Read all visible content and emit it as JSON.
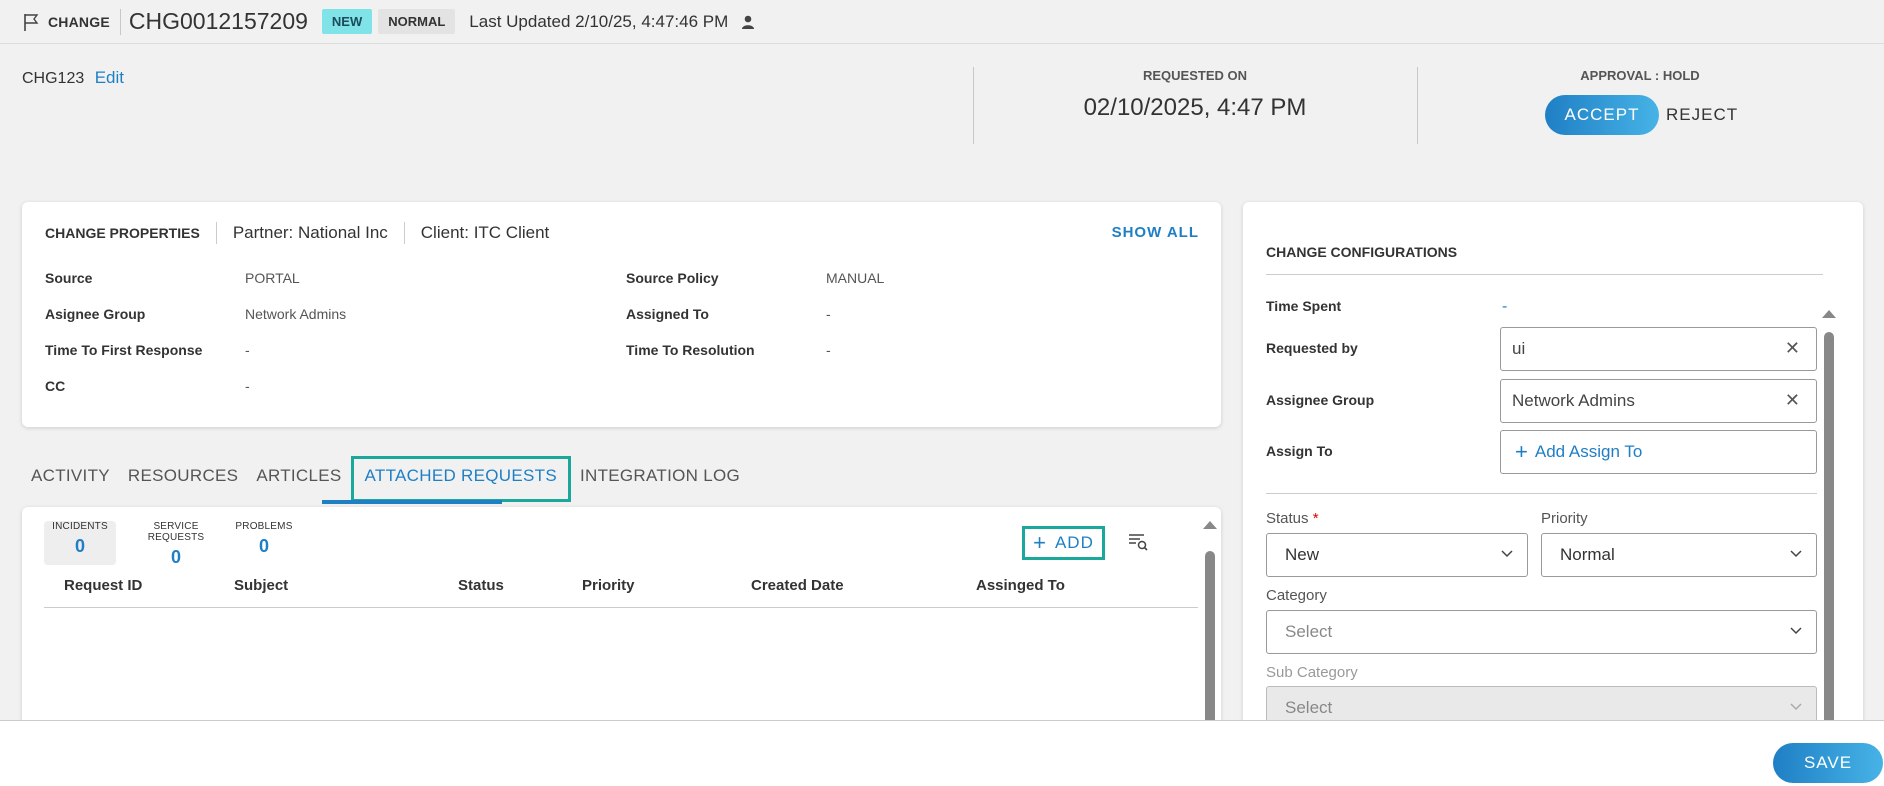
{
  "header": {
    "kind": "CHANGE",
    "number": "CHG0012157209",
    "status_badge": "NEW",
    "priority_badge": "NORMAL",
    "last_updated": "Last Updated 2/10/25, 4:47:46 PM"
  },
  "summary": {
    "id": "CHG123",
    "edit_label": "Edit",
    "requested_on_label": "REQUESTED ON",
    "requested_on_value": "02/10/2025, 4:47 PM",
    "approval_label": "APPROVAL : HOLD",
    "accept_label": "ACCEPT",
    "reject_label": "REJECT"
  },
  "properties": {
    "title": "CHANGE PROPERTIES",
    "partner": "Partner: National Inc",
    "client": "Client: ITC Client",
    "show_all": "SHOW ALL",
    "rows": [
      {
        "k": "Source",
        "v": "PORTAL"
      },
      {
        "k": "Asignee Group",
        "v": "Network Admins"
      },
      {
        "k": "Time To First Response",
        "v": "-"
      },
      {
        "k": "CC",
        "v": "-"
      },
      {
        "k": "Source Policy",
        "v": "MANUAL"
      },
      {
        "k": "Assigned To",
        "v": "-"
      },
      {
        "k": "Time To Resolution",
        "v": "-"
      }
    ]
  },
  "tabs": [
    {
      "label": "ACTIVITY"
    },
    {
      "label": "RESOURCES"
    },
    {
      "label": "ARTICLES"
    },
    {
      "label": "ATTACHED REQUESTS",
      "active": true
    },
    {
      "label": "INTEGRATION LOG"
    }
  ],
  "attached": {
    "counters": [
      {
        "label": "INCIDENTS",
        "count": "0"
      },
      {
        "label": "SERVICE REQUESTS",
        "count": "0"
      },
      {
        "label": "PROBLEMS",
        "count": "0"
      }
    ],
    "add_label": "ADD",
    "columns": [
      "Request ID",
      "Subject",
      "Status",
      "Priority",
      "Created Date",
      "Assinged To"
    ]
  },
  "config": {
    "title": "CHANGE CONFIGURATIONS",
    "time_spent_label": "Time Spent",
    "time_spent_value": "-",
    "requested_by_label": "Requested by",
    "requested_by_value": "ui",
    "assignee_group_label": "Assignee Group",
    "assignee_group_value": "Network Admins",
    "assign_to_label": "Assign To",
    "add_assign_label": "Add Assign To",
    "status_label": "Status",
    "status_required": "*",
    "status_value": "New",
    "priority_label": "Priority",
    "priority_value": "Normal",
    "category_label": "Category",
    "category_placeholder": "Select",
    "subcategory_label": "Sub Category",
    "subcategory_placeholder": "Select"
  },
  "footer": {
    "save_label": "SAVE"
  }
}
